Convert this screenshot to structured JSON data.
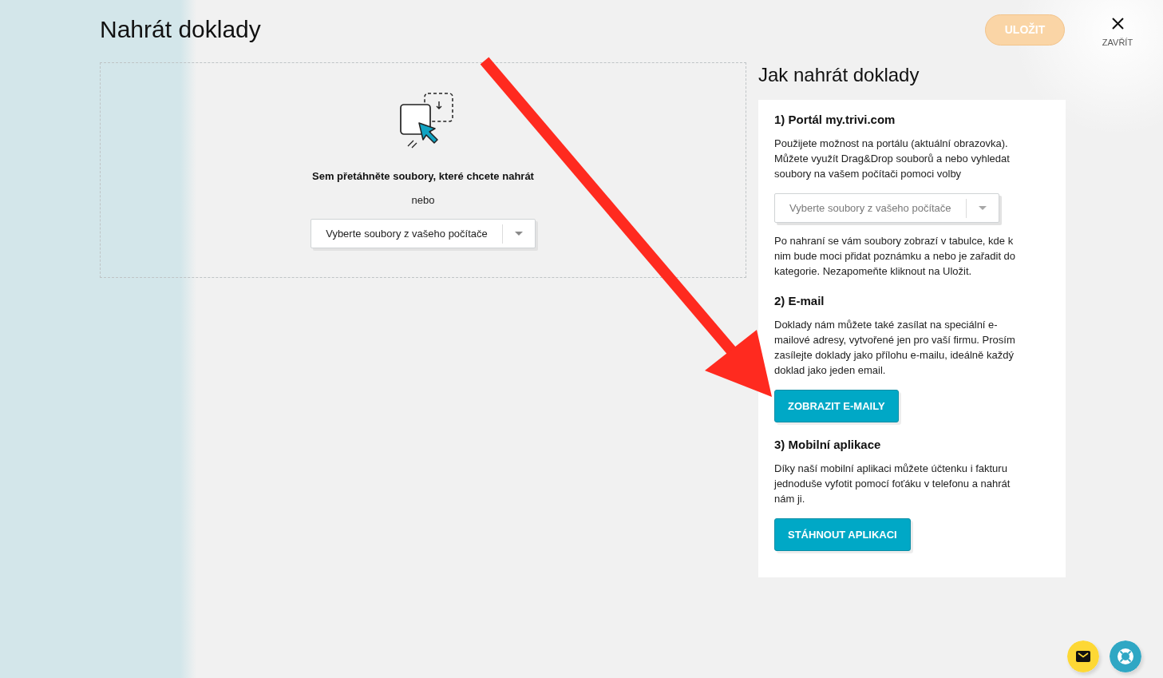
{
  "header": {
    "title": "Nahrát doklady",
    "save_button": {
      "label": "ULOŽIT",
      "disabled": true
    },
    "close_button": {
      "label": "ZAVŘÍT"
    }
  },
  "dropzone": {
    "prompt": "Sem přetáhněte soubory, které chcete nahrát",
    "separator": "nebo",
    "file_picker": {
      "label": "Vyberte soubory z vašeho počítače",
      "disabled": false
    }
  },
  "help": {
    "title": "Jak nahrát doklady",
    "sections": [
      {
        "heading": "1) Portál my.trivi.com",
        "blocks": [
          {
            "kind": "text",
            "text": "Použijete možnost na portálu (aktuální obrazovka). Můžete využít Drag&Drop souborů a nebo vyhledat soubory na vašem počítači pomoci volby"
          },
          {
            "kind": "picker",
            "label": "Vyberte soubory z vašeho počítače",
            "disabled": true
          },
          {
            "kind": "text",
            "text": "Po nahraní se vám soubory zobrazí v tabulce, kde k nim bude moci přidat poznámku a nebo je zařadit do kategorie. Nezapomeňte kliknout na Uložit."
          }
        ]
      },
      {
        "heading": "2) E-mail",
        "blocks": [
          {
            "kind": "text",
            "text": "Doklady nám můžete také zasílat na speciální e-mailové adresy, vytvořené jen pro vaší firmu. Prosím zasílejte doklady jako přílohu e-mailu, ideálně každý doklad jako jeden email."
          },
          {
            "kind": "button",
            "label": "ZOBRAZIT E-MAILY"
          }
        ]
      },
      {
        "heading": "3) Mobilní aplikace",
        "blocks": [
          {
            "kind": "text",
            "text": "Díky naší mobilní aplikaci můžete účtenku i fakturu jednoduše vyfotit pomocí foťáku v telefonu a nahrát nám ji."
          },
          {
            "kind": "button",
            "label": "STÁHNOUT APLIKACI"
          }
        ]
      }
    ]
  }
}
